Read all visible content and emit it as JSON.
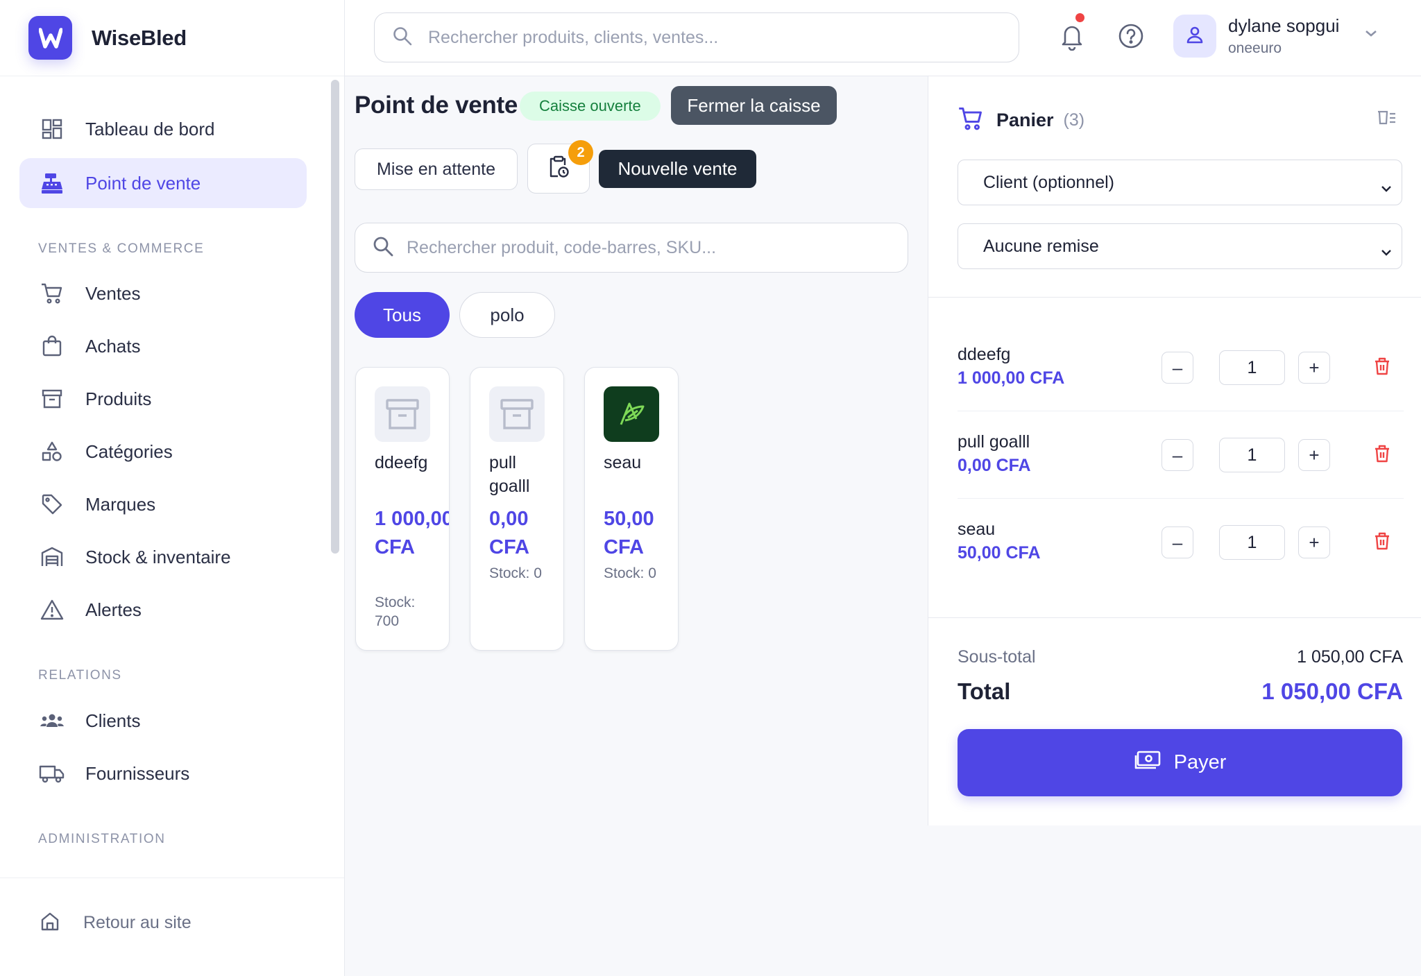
{
  "app": {
    "name": "WiseBled",
    "logo_letter": "W"
  },
  "colors": {
    "accent": "#4f46e5",
    "success_bg": "#dcfce7",
    "success_text": "#15803d",
    "danger": "#ef4444",
    "warning": "#f59e0b"
  },
  "sidebar": {
    "main_items": [
      {
        "label": "Tableau de bord",
        "icon": "dashboard-icon"
      },
      {
        "label": "Point de vente",
        "icon": "cash-register-icon",
        "active": true
      }
    ],
    "sections": [
      {
        "title": "VENTES & COMMERCE",
        "items": [
          {
            "label": "Ventes",
            "icon": "cart-icon"
          },
          {
            "label": "Achats",
            "icon": "shopping-bag-icon"
          },
          {
            "label": "Produits",
            "icon": "archive-box-icon"
          },
          {
            "label": "Catégories",
            "icon": "shapes-icon"
          },
          {
            "label": "Marques",
            "icon": "tag-icon"
          },
          {
            "label": "Stock & inventaire",
            "icon": "warehouse-icon"
          },
          {
            "label": "Alertes",
            "icon": "warning-icon"
          }
        ]
      },
      {
        "title": "RELATIONS",
        "items": [
          {
            "label": "Clients",
            "icon": "users-icon"
          },
          {
            "label": "Fournisseurs",
            "icon": "truck-icon"
          }
        ]
      },
      {
        "title": "ADMINISTRATION",
        "items": []
      }
    ],
    "footer_link": "Retour au site"
  },
  "header": {
    "search_placeholder": "Rechercher produits, clients, ventes...",
    "user": {
      "name": "dylane sopgui",
      "org": "oneeuro"
    }
  },
  "pos": {
    "title": "Point de vente",
    "status": "Caisse ouverte",
    "close_register": "Fermer la caisse",
    "hold": "Mise en attente",
    "held_count": "2",
    "new_sale": "Nouvelle vente",
    "search_placeholder": "Rechercher produit, code-barres, SKU...",
    "filters": [
      "Tous",
      "polo"
    ],
    "products": [
      {
        "name": "ddeefg",
        "price": "1 000,00 CFA",
        "stock": "Stock: 700",
        "image": "box-placeholder-icon"
      },
      {
        "name": "pull goalll",
        "price": "0,00 CFA",
        "stock": "Stock: 0",
        "image": "box-placeholder-icon"
      },
      {
        "name": "seau",
        "price": "50,00 CFA",
        "stock": "Stock: 0",
        "image": "leaf-logo-icon"
      }
    ]
  },
  "cart": {
    "title": "Panier",
    "count": "(3)",
    "client_select": "Client (optionnel)",
    "discount_select": "Aucune remise",
    "lines": [
      {
        "name": "ddeefg",
        "price": "1 000,00 CFA",
        "qty": "1"
      },
      {
        "name": "pull goalll",
        "price": "0,00 CFA",
        "qty": "1"
      },
      {
        "name": "seau",
        "price": "50,00 CFA",
        "qty": "1"
      }
    ],
    "subtotal_label": "Sous-total",
    "subtotal": "1 050,00 CFA",
    "total_label": "Total",
    "total": "1 050,00 CFA",
    "pay": "Payer"
  }
}
